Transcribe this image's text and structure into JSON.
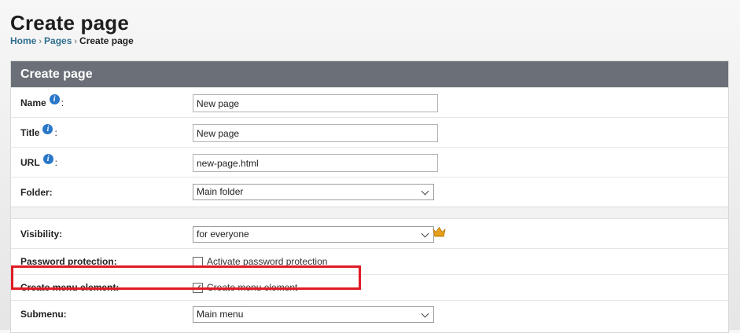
{
  "page": {
    "title": "Create page"
  },
  "breadcrumb": {
    "items": [
      "Home",
      "Pages"
    ],
    "current": "Create page",
    "separator": "›"
  },
  "panel": {
    "header": "Create page"
  },
  "form": {
    "name": {
      "label": "Name",
      "value": "New page"
    },
    "title": {
      "label": "Title",
      "value": "New page"
    },
    "url": {
      "label": "URL",
      "value": "new-page.html"
    },
    "folder": {
      "label": "Folder:",
      "selected": "Main folder"
    },
    "visibility": {
      "label": "Visibility:",
      "selected": "for everyone"
    },
    "password": {
      "label": "Password protection:",
      "checkbox_label": "Activate password protection",
      "checked": false
    },
    "menu_element": {
      "label": "Create menu element:",
      "checkbox_label": "Create menu element",
      "checked": true
    },
    "submenu": {
      "label": "Submenu:",
      "selected": "Main menu"
    }
  },
  "icons": {
    "info": "info-icon",
    "crown": "crown-icon",
    "dropdown": "chevron-down-icon"
  },
  "colors": {
    "panel_header_bg": "#6b7078",
    "link": "#2f6e8f",
    "highlight": "#e01b24",
    "info_icon": "#2a78c8",
    "crown": "#e8a21a"
  }
}
